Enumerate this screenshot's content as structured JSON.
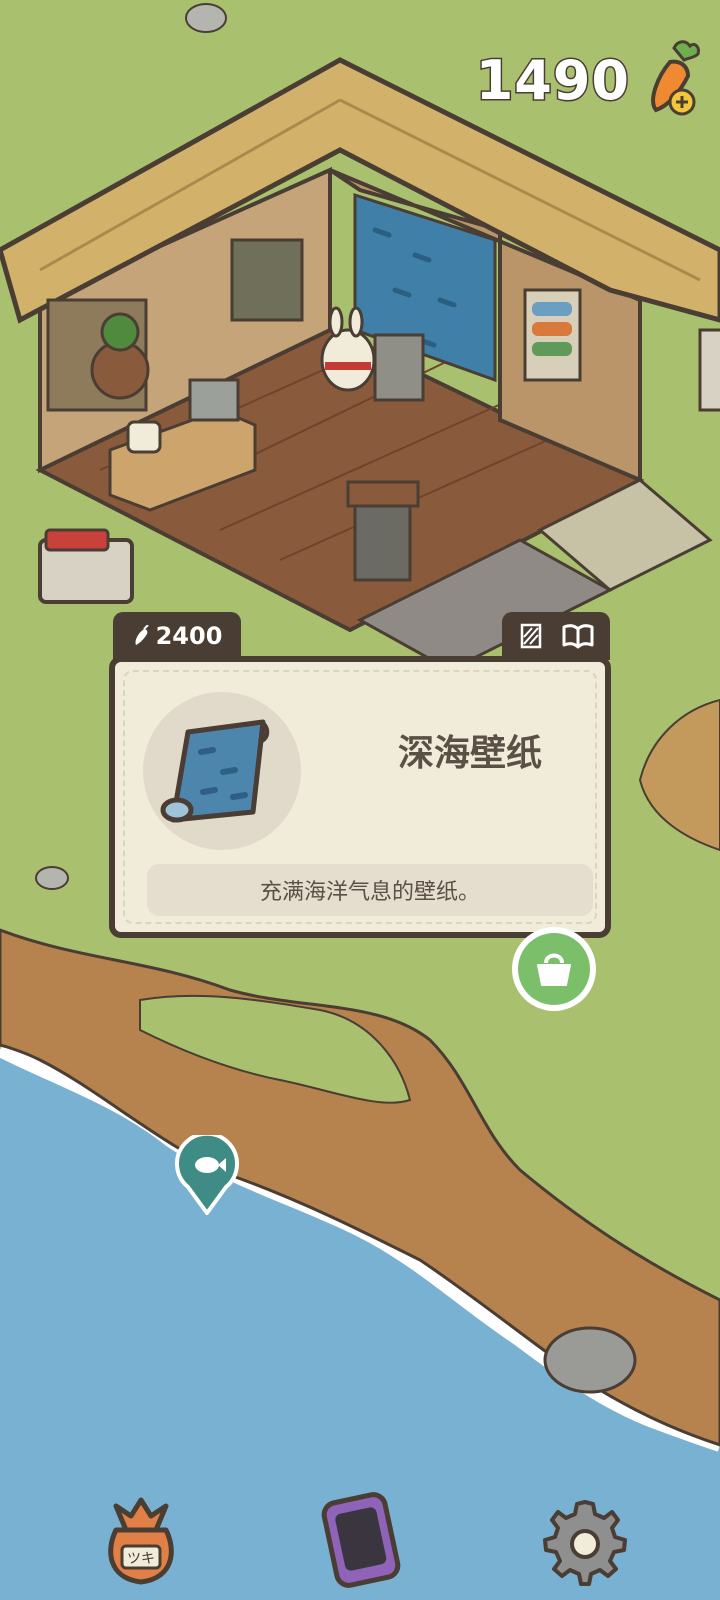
{
  "hud": {
    "carrots": "1490",
    "carrot_icon": "carrot-plus-icon"
  },
  "item_card": {
    "price": "2400",
    "price_icon": "carrot-icon",
    "name": "深海壁纸",
    "description": "充满海洋气息的壁纸。",
    "tab_icons": [
      "wallpaper-icon",
      "book-icon"
    ]
  },
  "actions": {
    "buy_icon": "shopping-bag-icon",
    "fish_marker_icon": "fish-icon"
  },
  "bottom_bar": {
    "left_icon": "pouch-icon",
    "pouch_text": "ツキ",
    "center_icon": "phone-icon",
    "right_icon": "gear-icon"
  },
  "colors": {
    "grass": "#a9c06e",
    "sea": "#79b1d2",
    "card_bg": "#f1ebd9",
    "card_border": "#4a3d33",
    "buy_green": "#7bbf6a",
    "pin_teal": "#3f8c86"
  }
}
